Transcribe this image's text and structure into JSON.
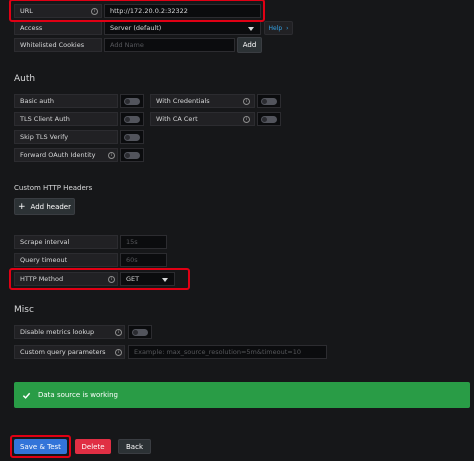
{
  "http": {
    "url_label": "URL",
    "url_value": "http://172.20.0.2:32322",
    "access_label": "Access",
    "access_value": "Server (default)",
    "help_label": "Help",
    "help_chevron": "›",
    "cookies_label": "Whitelisted Cookies",
    "cookies_placeholder": "Add Name",
    "add_label": "Add"
  },
  "auth": {
    "title": "Auth",
    "basic_auth": "Basic auth",
    "with_credentials": "With Credentials",
    "tls_client_auth": "TLS Client Auth",
    "with_ca_cert": "With CA Cert",
    "skip_tls_verify": "Skip TLS Verify",
    "forward_oauth": "Forward OAuth Identity"
  },
  "custom_headers": {
    "title": "Custom HTTP Headers",
    "add_header_label": "Add header",
    "add_icon": "+"
  },
  "prometheus": {
    "scrape_interval_label": "Scrape interval",
    "scrape_interval_placeholder": "15s",
    "query_timeout_label": "Query timeout",
    "query_timeout_placeholder": "60s",
    "http_method_label": "HTTP Method",
    "http_method_value": "GET"
  },
  "misc": {
    "title": "Misc",
    "disable_metrics_label": "Disable metrics lookup",
    "custom_query_label": "Custom query parameters",
    "custom_query_placeholder": "Example: max_source_resolution=5m&timeout=10"
  },
  "status": {
    "message": "Data source is working",
    "color": "#299c46"
  },
  "actions": {
    "save_test": "Save & Test",
    "delete": "Delete",
    "back": "Back"
  },
  "colors": {
    "primary": "#3274d9",
    "danger": "#e02f44",
    "highlight": "#e00014"
  },
  "icons": {
    "info": "i",
    "chevron": "chevron-down-icon",
    "check": "check-icon"
  }
}
